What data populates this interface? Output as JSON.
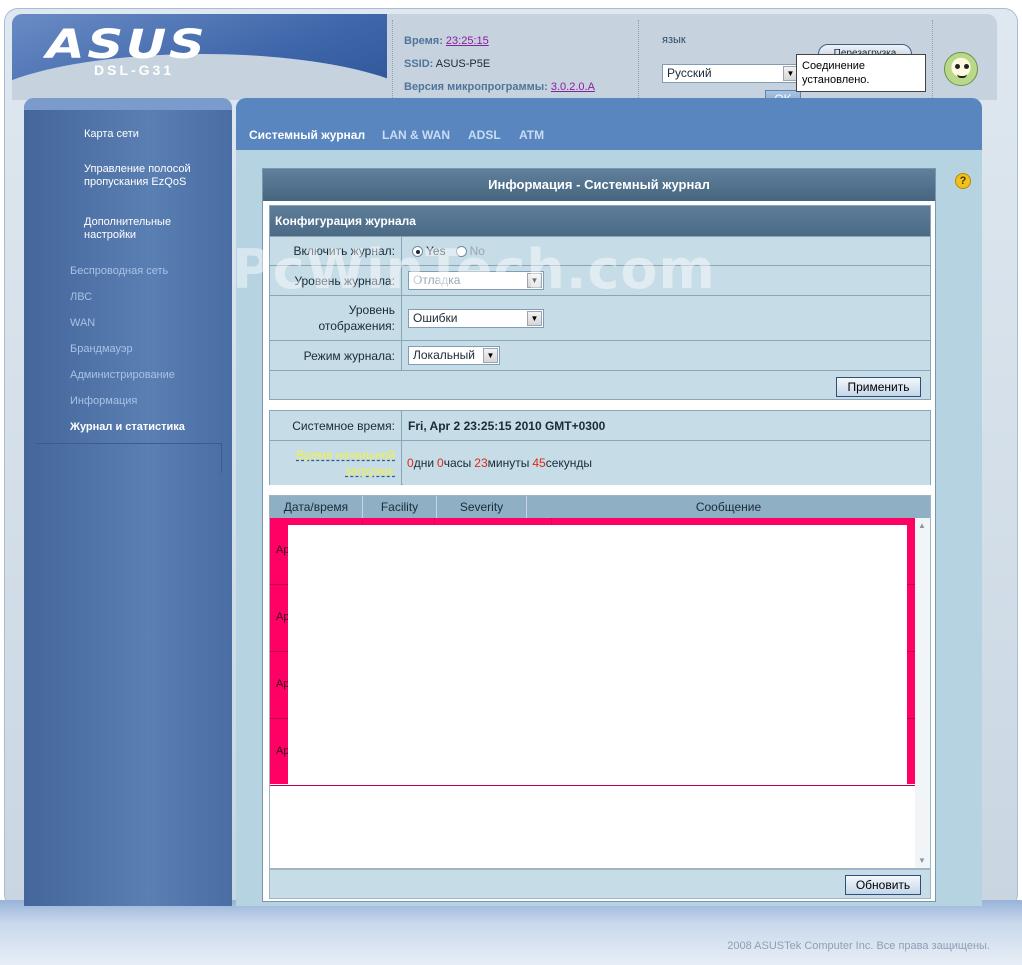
{
  "header": {
    "logo": "ASUS",
    "model": "DSL-G31",
    "time_label": "Время:",
    "time_value": "23:25:15",
    "ssid_label": "SSID:",
    "ssid_value": "ASUS-P5E",
    "firmware_label": "Версия микропрограммы:",
    "firmware_value": "3.0.2.0.A",
    "lang_label": "язык",
    "lang_selected": "Русский",
    "ok_label": "OK",
    "restart_label": "Перезагрузка",
    "status_tooltip": "Соединение установлено."
  },
  "sidebar": {
    "sub_items": [
      {
        "label": "Карта сети"
      },
      {
        "label": "Управление полосой пропускания EzQoS"
      },
      {
        "label": "Дополнительные настройки"
      }
    ],
    "items": [
      {
        "label": "Беспроводная сеть"
      },
      {
        "label": "ЛВС"
      },
      {
        "label": "WAN"
      },
      {
        "label": "Брандмауэр"
      },
      {
        "label": "Администрирование"
      },
      {
        "label": "Информация"
      },
      {
        "label": "Журнал и статистика"
      }
    ]
  },
  "tabs": [
    {
      "label": "Системный журнал"
    },
    {
      "label": "LAN & WAN"
    },
    {
      "label": "ADSL"
    },
    {
      "label": "ATM"
    }
  ],
  "panel": {
    "title": "Информация - Системный журнал",
    "config": {
      "heading": "Конфигурация журнала",
      "enable_label": "Включить журнал:",
      "yes_label": "Yes",
      "no_label": "No",
      "log_level_label": "Уровень журнала:",
      "log_level_value": "Отладка",
      "display_level_label": "Уровень отображения:",
      "display_level_value": "Ошибки",
      "mode_label": "Режим журнала:",
      "mode_value": "Локальный",
      "apply_label": "Применить"
    },
    "time": {
      "system_time_label": "Системное время:",
      "system_time_value": "Fri, Apr 2   23:25:15  2010 GMT+0300",
      "uptime_label": "Время начальной загрузки:",
      "days": "0",
      "days_unit": "дни",
      "hours": "0",
      "hours_unit": "часы",
      "minutes": "23",
      "minutes_unit": "минуты",
      "seconds": "45",
      "seconds_unit": "секунды"
    },
    "log_table": {
      "columns": [
        "Дата/время",
        "Facility",
        "Severity",
        "Сообщение"
      ],
      "rows": [
        {
          "date": "Ap"
        },
        {
          "date": "Ap"
        },
        {
          "date": "Ap"
        },
        {
          "date": "Ap"
        }
      ]
    },
    "refresh_label": "Обновить"
  },
  "watermark": "PcWinTech.com",
  "footer": {
    "copyright": "2008 ASUSTek Computer Inc. Все права защищены."
  },
  "colors": {
    "accent_blue": "#5a86c0",
    "log_highlight": "#ff0065",
    "uptime_red": "#e02818"
  }
}
